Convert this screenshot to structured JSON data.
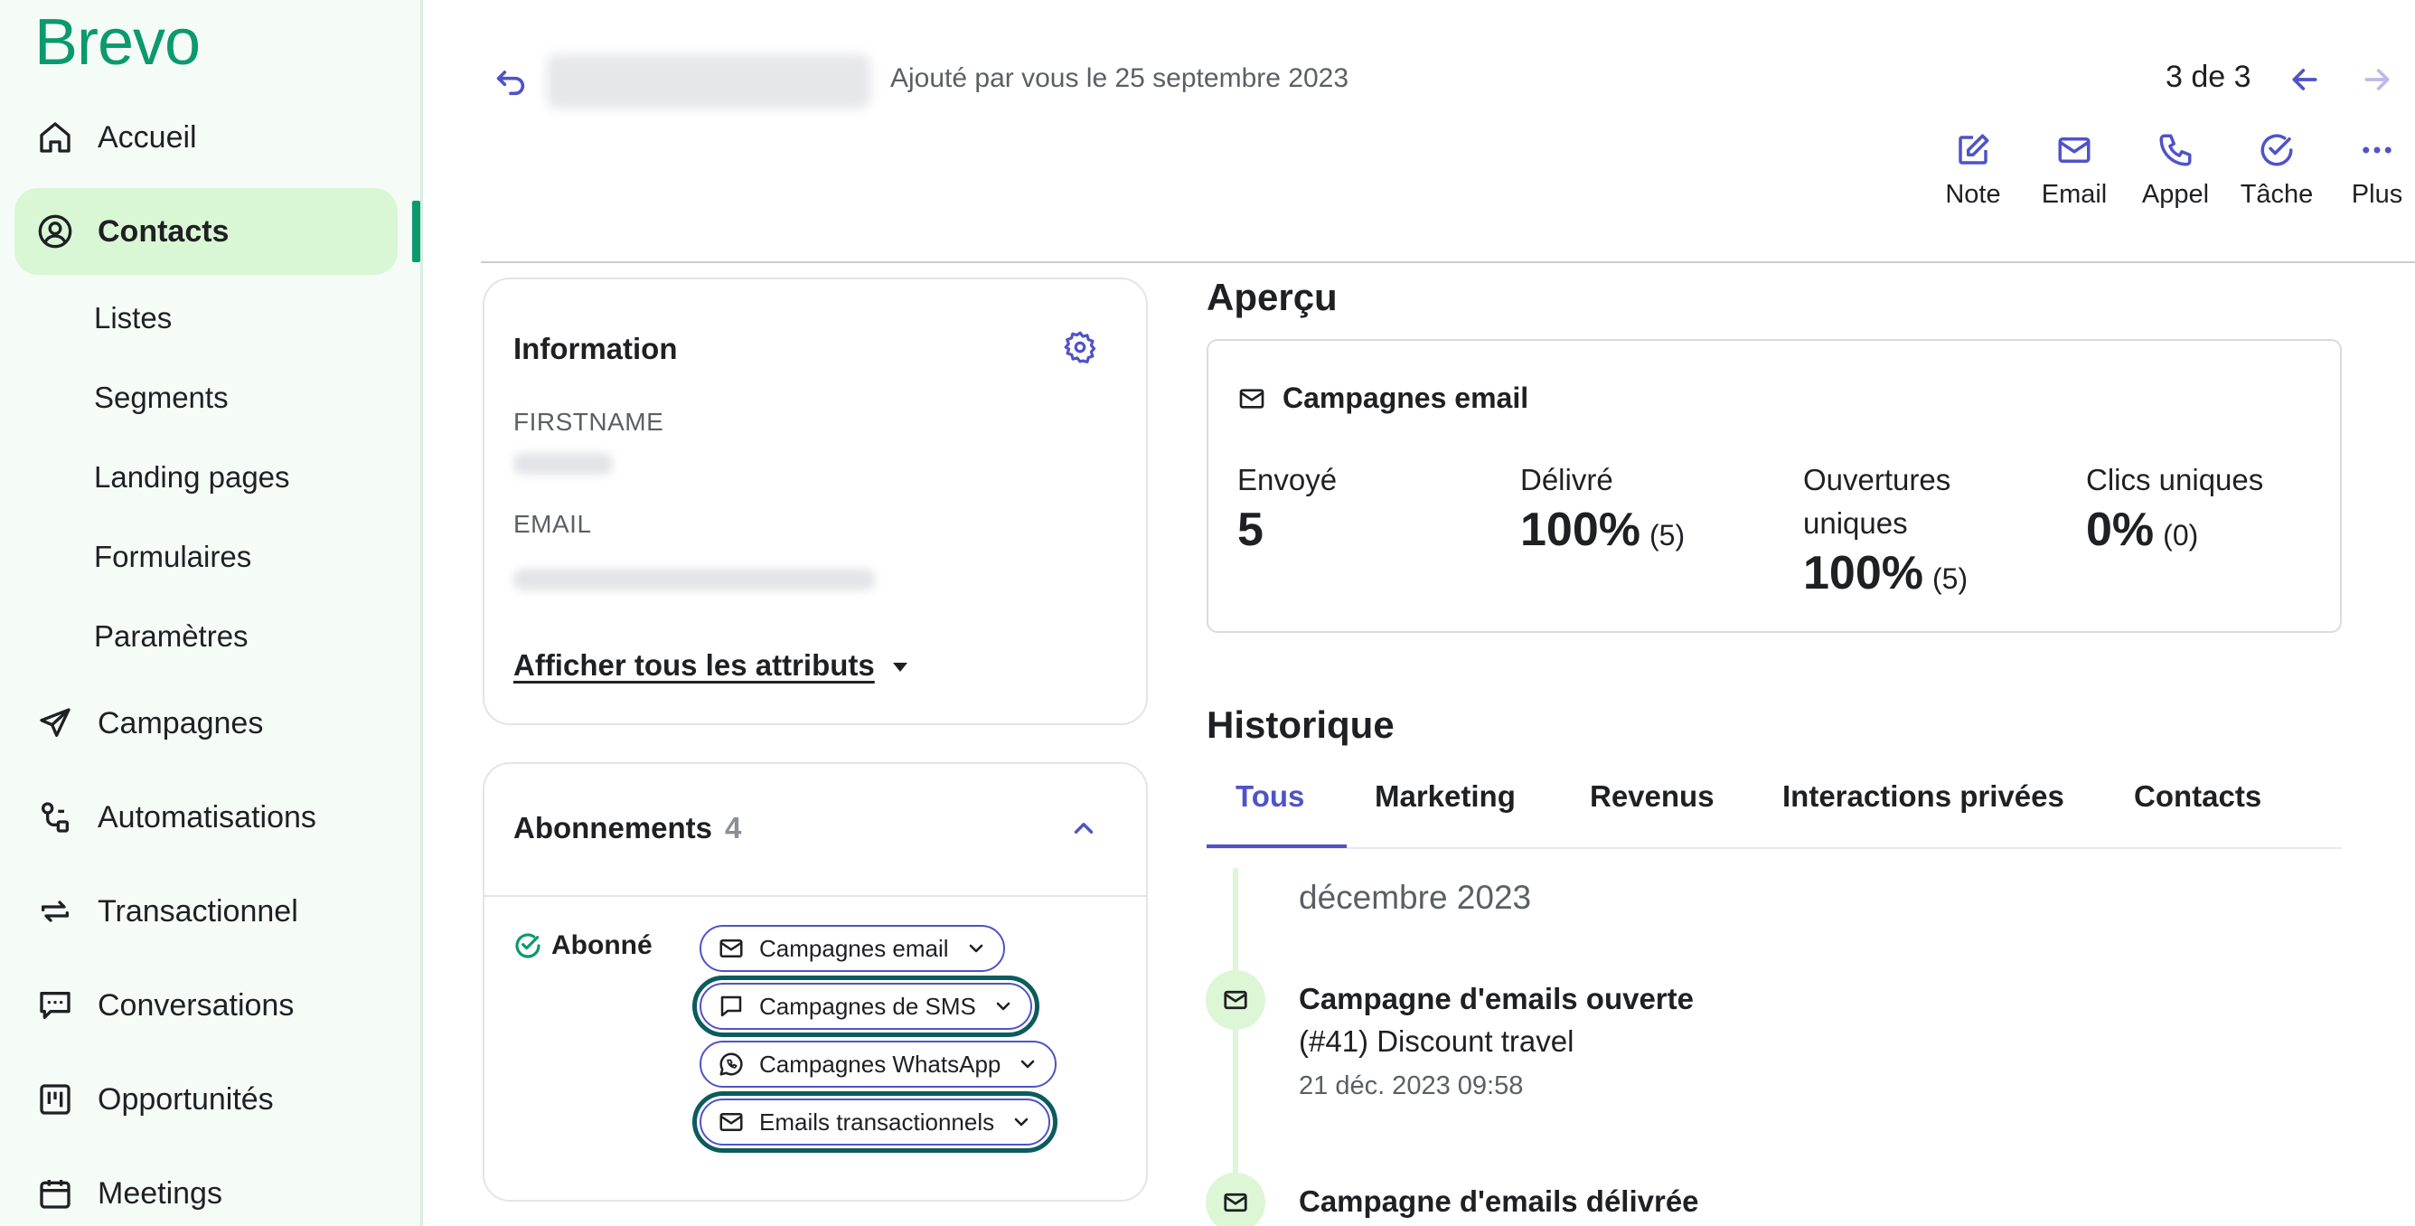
{
  "brand": {
    "logo": "Brevo",
    "accent": "#0b996e",
    "link": "#4f53c7"
  },
  "sidebar": {
    "items": [
      {
        "label": "Accueil",
        "icon": "home-icon"
      },
      {
        "label": "Contacts",
        "icon": "contacts-icon",
        "active": true
      },
      {
        "label": "Campagnes",
        "icon": "send-icon"
      },
      {
        "label": "Automatisations",
        "icon": "automation-icon"
      },
      {
        "label": "Transactionnel",
        "icon": "transactional-icon"
      },
      {
        "label": "Conversations",
        "icon": "chat-icon"
      },
      {
        "label": "Opportunités",
        "icon": "kanban-icon"
      },
      {
        "label": "Meetings",
        "icon": "calendar-icon"
      }
    ],
    "subitems": [
      "Listes",
      "Segments",
      "Landing pages",
      "Formulaires",
      "Paramètres"
    ]
  },
  "header": {
    "added_text": "Ajouté par vous le 25 septembre 2023",
    "pager": "3 de 3",
    "actions": [
      {
        "label": "Note",
        "icon": "edit-icon"
      },
      {
        "label": "Email",
        "icon": "mail-icon"
      },
      {
        "label": "Appel",
        "icon": "phone-icon"
      },
      {
        "label": "Tâche",
        "icon": "check-circle-icon"
      },
      {
        "label": "Plus",
        "icon": "more-icon"
      }
    ]
  },
  "information": {
    "title": "Information",
    "attributes": [
      {
        "label": "FIRSTNAME"
      },
      {
        "label": "EMAIL"
      }
    ],
    "show_all": "Afficher tous les attributs"
  },
  "subscriptions": {
    "title": "Abonnements",
    "count": "4",
    "status": "Abonné",
    "channels": [
      {
        "label": "Campagnes email",
        "icon": "mail-icon"
      },
      {
        "label": "Campagnes de SMS",
        "icon": "sms-icon"
      },
      {
        "label": "Campagnes WhatsApp",
        "icon": "whatsapp-icon"
      },
      {
        "label": "Emails transactionnels",
        "icon": "mail-icon"
      }
    ]
  },
  "overview": {
    "title": "Aperçu",
    "card_title": "Campagnes email",
    "stats": [
      {
        "label": "Envoyé",
        "value": "5",
        "sub": ""
      },
      {
        "label": "Délivré",
        "value": "100%",
        "sub": "(5)"
      },
      {
        "label": "Ouvertures uniques",
        "value": "100%",
        "sub": "(5)"
      },
      {
        "label": "Clics uniques",
        "value": "0%",
        "sub": "(0)"
      }
    ]
  },
  "history": {
    "title": "Historique",
    "tabs": [
      "Tous",
      "Marketing",
      "Revenus",
      "Interactions privées",
      "Contacts"
    ],
    "month": "décembre 2023",
    "events": [
      {
        "title": "Campagne d'emails ouverte",
        "subtitle": "(#41) Discount travel",
        "date": "21 déc. 2023 09:58"
      },
      {
        "title": "Campagne d'emails délivrée"
      }
    ]
  }
}
